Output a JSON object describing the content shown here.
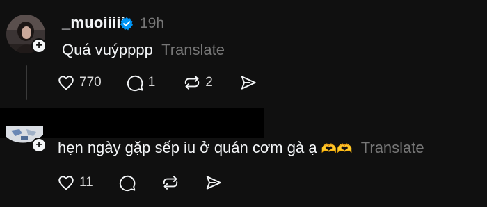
{
  "post1": {
    "username": "_muoiiiii",
    "verified_icon": "verified-badge-icon",
    "time": "19h",
    "text": "Quá vuýpppp",
    "translate_label": "Translate",
    "actions": {
      "likes": "770",
      "replies": "1",
      "reposts": "2"
    }
  },
  "post2": {
    "text": "hẹn ngày gặp sếp iu ở quán cơm gà ạ",
    "emoji": "🫶🫶",
    "translate_label": "Translate",
    "actions": {
      "likes": "11"
    }
  },
  "colors": {
    "background": "#101010",
    "text": "#f3f5f7",
    "muted": "#777777",
    "verified": "#0095f6"
  }
}
